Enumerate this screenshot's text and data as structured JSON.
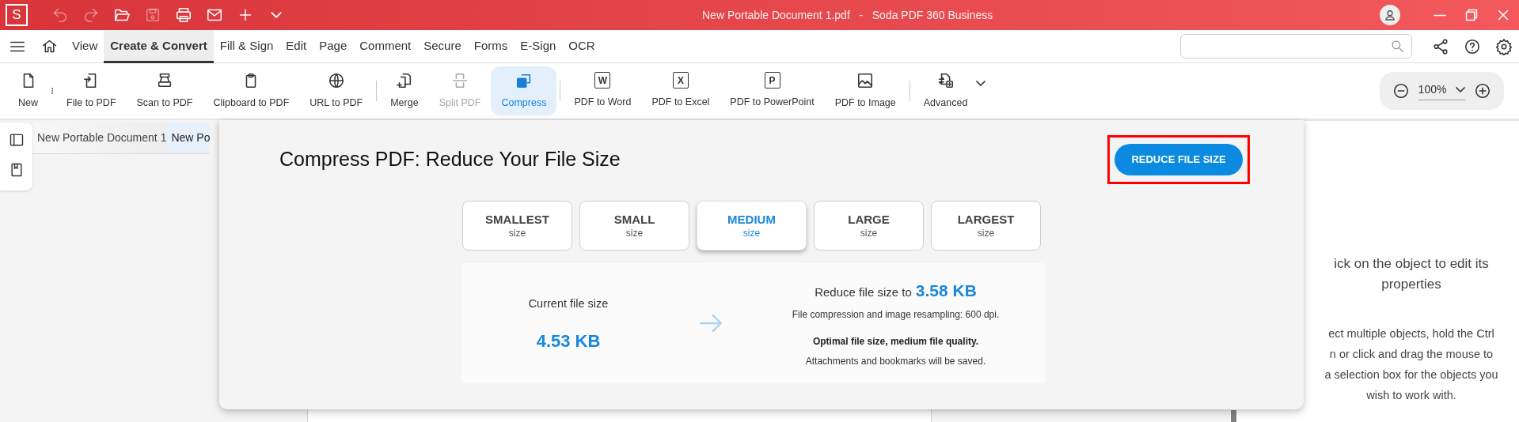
{
  "title_bar": {
    "logo_letter": "S",
    "quick_access": [
      {
        "disabled": true
      },
      {
        "disabled": true
      },
      {
        "disabled": false
      },
      {
        "disabled": true
      },
      {
        "disabled": false
      },
      {
        "disabled": false
      },
      {
        "disabled": false
      },
      {
        "disabled": false
      }
    ],
    "title": "New Portable Document 1.pdf   -   Soda PDF 360 Business"
  },
  "menu_tabs": [
    {
      "label": "View",
      "selected": false
    },
    {
      "label": "Create & Convert",
      "selected": true
    },
    {
      "label": "Fill & Sign",
      "selected": false
    },
    {
      "label": "Edit",
      "selected": false
    },
    {
      "label": "Page",
      "selected": false
    },
    {
      "label": "Comment",
      "selected": false
    },
    {
      "label": "Secure",
      "selected": false
    },
    {
      "label": "Forms",
      "selected": false
    },
    {
      "label": "E-Sign",
      "selected": false
    },
    {
      "label": "OCR",
      "selected": false
    }
  ],
  "toolbar": [
    {
      "label": "New",
      "selected": false,
      "disabled": false
    },
    {
      "label": "File to PDF",
      "selected": false,
      "disabled": false
    },
    {
      "label": "Scan to PDF",
      "selected": false,
      "disabled": false
    },
    {
      "label": "Clipboard to PDF",
      "selected": false,
      "disabled": false
    },
    {
      "label": "URL to PDF",
      "selected": false,
      "disabled": false
    },
    {
      "label": "Merge",
      "selected": false,
      "disabled": false
    },
    {
      "label": "Split PDF",
      "selected": false,
      "disabled": true
    },
    {
      "label": "Compress",
      "selected": true,
      "disabled": false
    },
    {
      "label": "PDF to Word",
      "selected": false,
      "disabled": false,
      "icon_letter": "W"
    },
    {
      "label": "PDF to Excel",
      "selected": false,
      "disabled": false,
      "icon_letter": "X"
    },
    {
      "label": "PDF to PowerPoint",
      "selected": false,
      "disabled": false,
      "icon_letter": "P"
    },
    {
      "label": "PDF to Image",
      "selected": false,
      "disabled": false
    },
    {
      "label": "Advanced",
      "selected": false,
      "disabled": false
    }
  ],
  "zoom": {
    "value": "100%"
  },
  "document_tabs": [
    {
      "label": "New Portable Document 1",
      "selected": false
    },
    {
      "label": "New Po",
      "selected": true
    }
  ],
  "compress_panel": {
    "title": "Compress PDF: Reduce Your File Size",
    "action_button": "REDUCE FILE SIZE",
    "highlighted": true,
    "options": [
      {
        "label": "SMALLEST",
        "sub": "size",
        "selected": false
      },
      {
        "label": "SMALL",
        "sub": "size",
        "selected": false
      },
      {
        "label": "MEDIUM",
        "sub": "size",
        "selected": true
      },
      {
        "label": "LARGE",
        "sub": "size",
        "selected": false
      },
      {
        "label": "LARGEST",
        "sub": "size",
        "selected": false
      }
    ],
    "current_label": "Current file size",
    "current_size": "4.53 KB",
    "reduce_label": "Reduce file size to",
    "target_size": "3.58 KB",
    "detail": "File compression and image resampling: 600 dpi.",
    "quality": "Optimal file size, medium file quality.",
    "note": "Attachments and bookmarks will be saved."
  },
  "properties_panel": {
    "heading_lines": [
      "ick on the object to edit its",
      "properties"
    ],
    "body_lines": [
      "ect multiple objects, hold the Ctrl",
      "n or click and drag the mouse to",
      "a selection box for the objects you",
      "wish to work with."
    ]
  }
}
